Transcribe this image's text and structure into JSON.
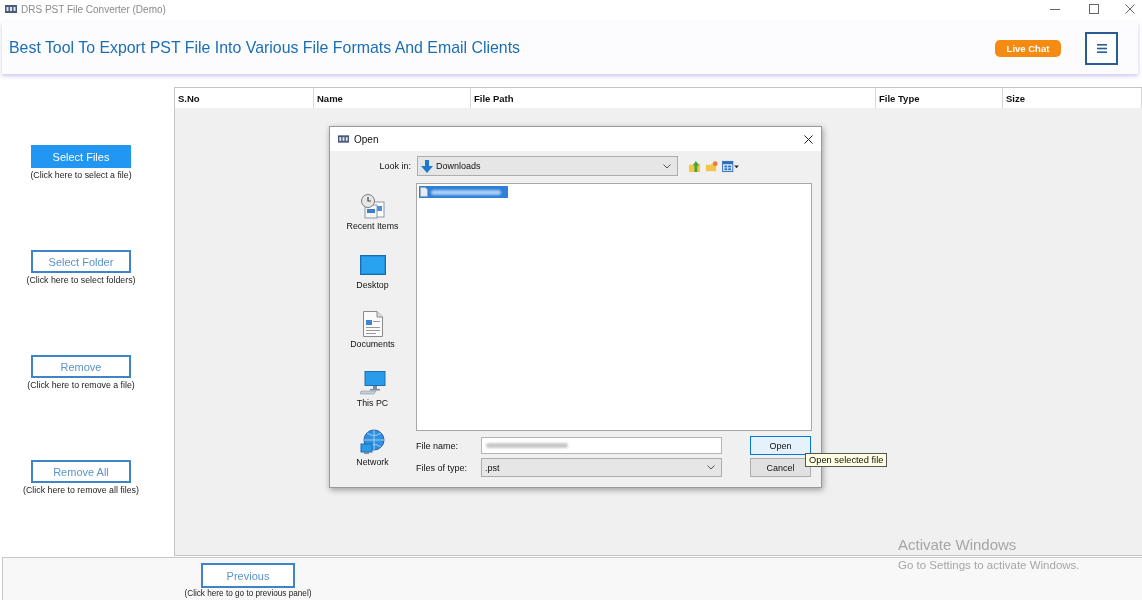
{
  "window": {
    "title": "DRS PST File Converter (Demo)"
  },
  "header": {
    "title": "Best Tool To Export PST File Into Various File Formats And Email Clients",
    "live_chat": "Live Chat"
  },
  "side_actions": [
    {
      "label": "Select Files",
      "hint": "(Click here to select a file)",
      "highlighted": true
    },
    {
      "label": "Select Folder",
      "hint": "(Click here to select folders)",
      "highlighted": false
    },
    {
      "label": "Remove",
      "hint": "(Click here to remove a file)",
      "highlighted": false
    },
    {
      "label": "Remove All",
      "hint": "(Click here to remove all files)",
      "highlighted": false
    }
  ],
  "table": {
    "columns": [
      "S.No",
      "Name",
      "File Path",
      "File Type",
      "Size"
    ]
  },
  "footer": {
    "button": "Previous",
    "hint": "(Click here to go to previous panel)"
  },
  "dialog": {
    "title": "Open",
    "look_in_label": "Look in:",
    "look_in_value": "Downloads",
    "places": [
      {
        "label": "Recent Items",
        "kind": "recent"
      },
      {
        "label": "Desktop",
        "kind": "desktop"
      },
      {
        "label": "Documents",
        "kind": "documents"
      },
      {
        "label": "This PC",
        "kind": "pc"
      },
      {
        "label": "Network",
        "kind": "network"
      }
    ],
    "files": [
      {
        "selected": true
      }
    ],
    "file_name_label": "File name:",
    "file_type_label": "Files of type:",
    "file_type_value": ".pst",
    "buttons": [
      {
        "label": "Open",
        "focused": true
      },
      {
        "label": "Cancel",
        "focused": false
      }
    ],
    "tooltip": "Open selected file"
  },
  "watermark": {
    "title": "Activate Windows",
    "subtitle": "Go to Settings to activate Windows."
  }
}
